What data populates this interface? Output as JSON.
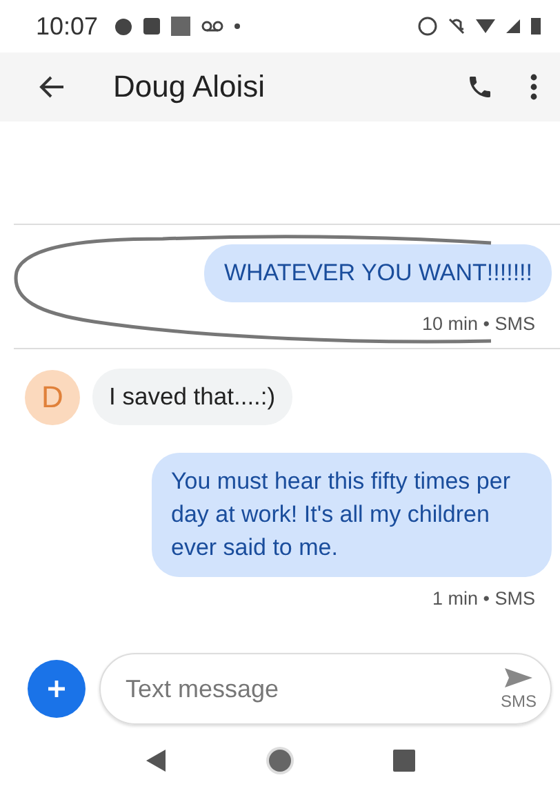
{
  "status_bar": {
    "time": "10:07"
  },
  "header": {
    "title": "Doug Aloisi"
  },
  "groups": [
    {
      "messages": [
        {
          "kind": "sent",
          "text": "WHATEVER YOU WANT!!!!!!!",
          "meta": "10 min • SMS",
          "circled": true
        }
      ]
    },
    {
      "messages": [
        {
          "kind": "received",
          "avatar": "D",
          "text": "I saved that....:)"
        },
        {
          "kind": "sent",
          "text": "You must hear this fifty times per day at work!  It's all my children ever said to me.",
          "meta": "1 min • SMS",
          "circled": false
        }
      ]
    }
  ],
  "composer": {
    "placeholder": "Text message",
    "send_label": "SMS"
  }
}
